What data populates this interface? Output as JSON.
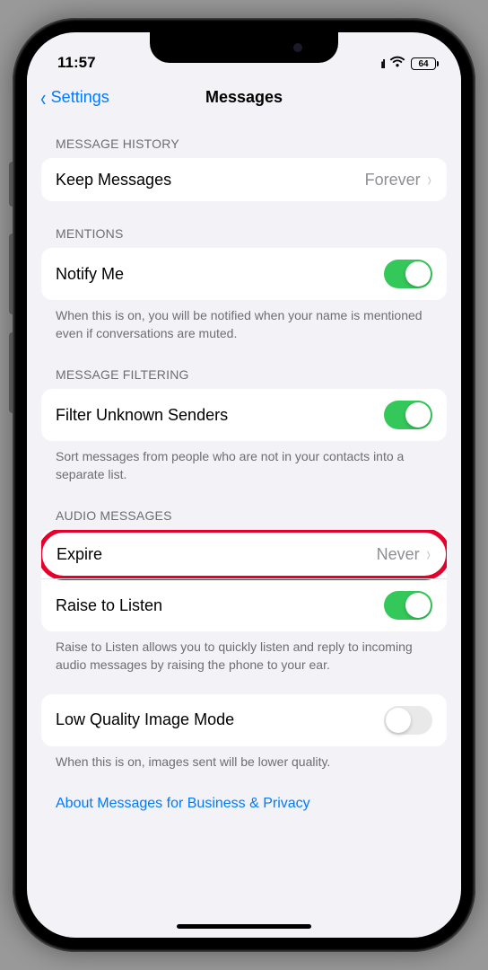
{
  "status": {
    "time": "11:57",
    "battery": "64"
  },
  "nav": {
    "back_label": "Settings",
    "title": "Messages"
  },
  "sections": {
    "message_history": {
      "header": "Message History",
      "keep_messages": {
        "label": "Keep Messages",
        "value": "Forever"
      }
    },
    "mentions": {
      "header": "Mentions",
      "notify_me": {
        "label": "Notify Me",
        "on": true
      },
      "footer": "When this is on, you will be notified when your name is mentioned even if conversations are muted."
    },
    "message_filtering": {
      "header": "Message Filtering",
      "filter_unknown": {
        "label": "Filter Unknown Senders",
        "on": true
      },
      "footer": "Sort messages from people who are not in your contacts into a separate list."
    },
    "audio_messages": {
      "header": "Audio Messages",
      "expire": {
        "label": "Expire",
        "value": "Never"
      },
      "raise_to_listen": {
        "label": "Raise to Listen",
        "on": true
      },
      "footer": "Raise to Listen allows you to quickly listen and reply to incoming audio messages by raising the phone to your ear."
    },
    "low_quality": {
      "label": "Low Quality Image Mode",
      "on": false,
      "footer": "When this is on, images sent will be lower quality."
    },
    "about_link": "About Messages for Business & Privacy"
  }
}
